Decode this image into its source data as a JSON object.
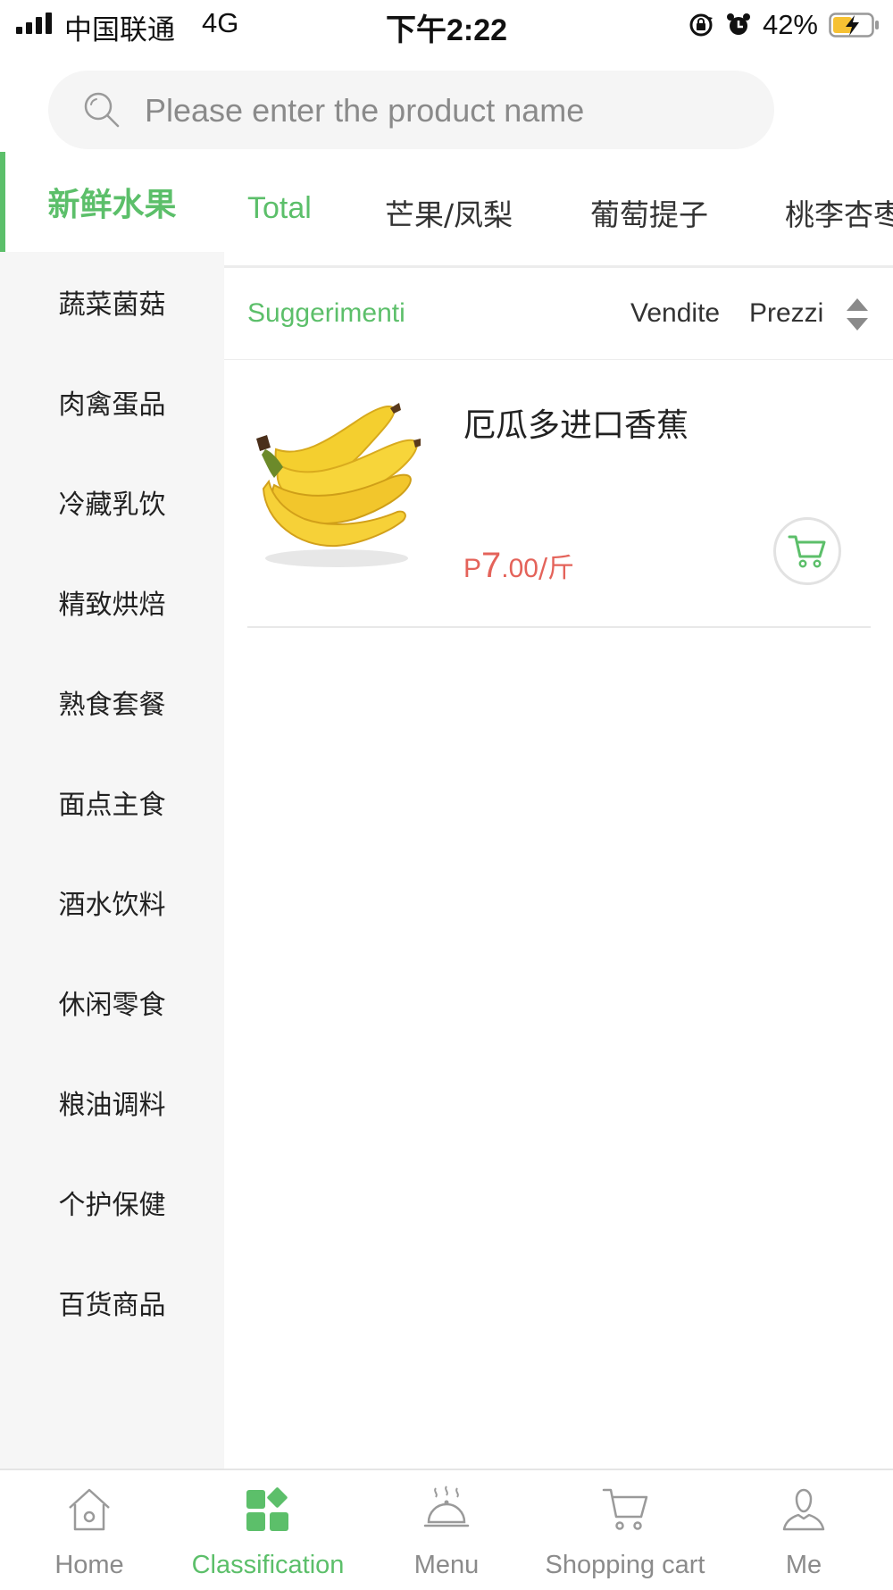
{
  "status_bar": {
    "carrier": "中国联通",
    "network": "4G",
    "time": "下午2:22",
    "battery": "42%"
  },
  "search": {
    "placeholder": "Please enter the product name"
  },
  "sidebar": {
    "items": [
      {
        "label": "新鲜水果",
        "active": true
      },
      {
        "label": "蔬菜菌菇"
      },
      {
        "label": "肉禽蛋品"
      },
      {
        "label": "冷藏乳饮"
      },
      {
        "label": "精致烘焙"
      },
      {
        "label": "熟食套餐"
      },
      {
        "label": "面点主食"
      },
      {
        "label": "酒水饮料"
      },
      {
        "label": "休闲零食"
      },
      {
        "label": "粮油调料"
      },
      {
        "label": "个护保健"
      },
      {
        "label": "百货商品"
      }
    ]
  },
  "subtabs": [
    {
      "label": "Total",
      "active": true
    },
    {
      "label": "芒果/凤梨"
    },
    {
      "label": "葡萄提子"
    },
    {
      "label": "桃李杏枣"
    }
  ],
  "sort": {
    "suggest": "Suggerimenti",
    "sales": "Vendite",
    "price": "Prezzi"
  },
  "products": [
    {
      "name": "厄瓜多进口香蕉",
      "price_prefix": "P",
      "price_int": "7",
      "price_rest": ".00",
      "price_unit": "/斤",
      "image_icon": "banana-image"
    }
  ],
  "bottom_nav": [
    {
      "label": "Home",
      "icon": "home-icon"
    },
    {
      "label": "Classification",
      "icon": "classification-icon",
      "active": true
    },
    {
      "label": "Menu",
      "icon": "menu-cloche-icon"
    },
    {
      "label": "Shopping cart",
      "icon": "shopping-cart-icon"
    },
    {
      "label": "Me",
      "icon": "person-icon"
    }
  ],
  "colors": {
    "accent": "#5cbf6a",
    "price": "#e4635a",
    "sidebar_bg": "#f6f6f6"
  }
}
